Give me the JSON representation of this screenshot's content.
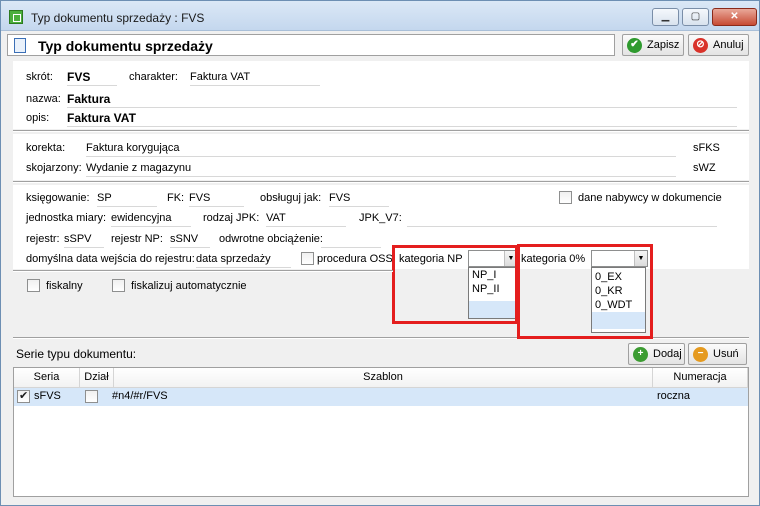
{
  "window": {
    "title": "Typ dokumentu sprzedaży : FVS",
    "header": "Typ dokumentu sprzedaży",
    "save_label": "Zapisz",
    "cancel_label": "Anuluj"
  },
  "fields": {
    "skrot_label": "skrót:",
    "skrot_value": "FVS",
    "charakter_label": "charakter:",
    "charakter_value": "Faktura VAT",
    "nazwa_label": "nazwa:",
    "nazwa_value": "Faktura",
    "opis_label": "opis:",
    "opis_value": "Faktura VAT",
    "korekta_label": "korekta:",
    "korekta_value": "Faktura korygująca",
    "korekta_code": "sFKS",
    "skojarzony_label": "skojarzony:",
    "skojarzony_value": "Wydanie z magazynu",
    "skojarzony_code": "sWZ",
    "ksiegowanie_label": "księgowanie:",
    "ksiegowanie_value": "SP",
    "fk_label": "FK:",
    "fk_value": "FVS",
    "obsluguj_label": "obsługuj jak:",
    "obsluguj_value": "FVS",
    "dane_nabywcy_label": "dane nabywcy w dokumencie",
    "jednostka_label": "jednostka miary:",
    "jednostka_value": "ewidencyjna",
    "rodzaj_jpk_label": "rodzaj JPK:",
    "rodzaj_jpk_value": "VAT",
    "jpk_v7_label": "JPK_V7:",
    "rejestr_label": "rejestr:",
    "rejestr_value": "sSPV",
    "rejestr_np_label": "rejestr NP:",
    "rejestr_np_value": "sSNV",
    "odwrotne_label": "odwrotne obciążenie:",
    "data_wejscia_label": "domyślna data wejścia do rejestru:",
    "data_wejscia_value": "data sprzedaży",
    "procedura_oss_label": "procedura OSS",
    "kategoria_np_label": "kategoria NP",
    "kategoria_zero_label": "kategoria 0%",
    "fiskalny_label": "fiskalny",
    "fiskalizuj_label": "fiskalizuj automatycznie"
  },
  "dropdowns": {
    "kategoria_np_options": [
      "NP_I",
      "NP_II"
    ],
    "kategoria_zero_options": [
      "0_EX",
      "0_KR",
      "0_WDT"
    ]
  },
  "series": {
    "section_label": "Serie typu dokumentu:",
    "add_label": "Dodaj",
    "remove_label": "Usuń",
    "columns": [
      "Seria",
      "Dział",
      "Szablon",
      "Numeracja"
    ],
    "rows": [
      {
        "checked": true,
        "seria": "sFVS",
        "dzial_checked": false,
        "szablon": "#n4/#r/FVS",
        "numeracja": "roczna"
      }
    ]
  },
  "colors": {
    "highlight_box": "#e41e1e",
    "selection": "#d6e7f9"
  }
}
